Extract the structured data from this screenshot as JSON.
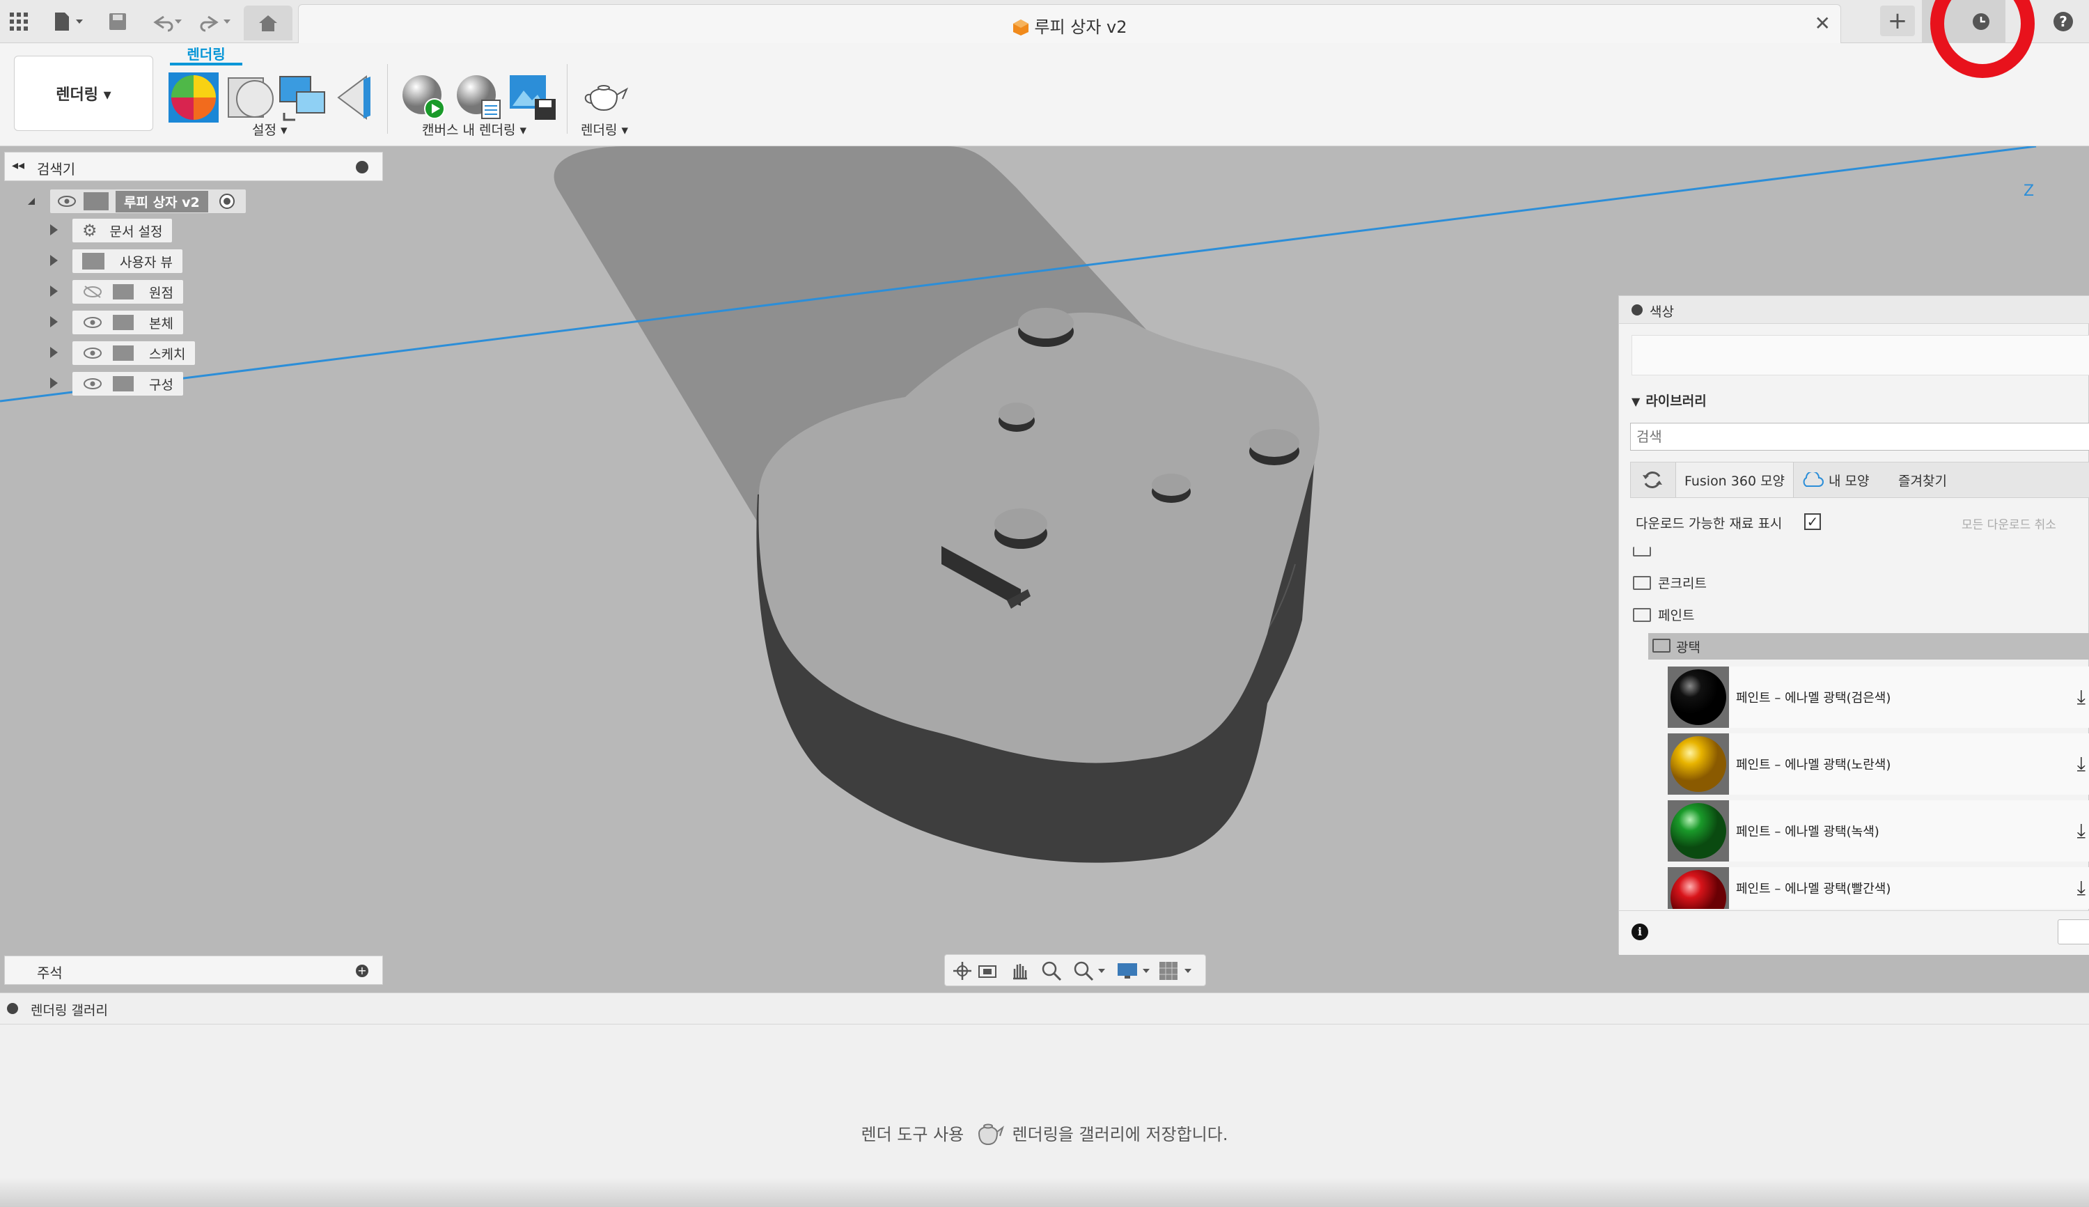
{
  "window": {
    "title": "루피 상자 v2"
  },
  "toolbar": {
    "workspace_label": "렌더링 ▾",
    "active_tab": "렌더링",
    "setup_group": "설정 ▾",
    "canvas_render_group": "캔버스 내 렌더링 ▾",
    "render_group": "렌더링 ▾"
  },
  "browser": {
    "title": "검색기",
    "root": "루피 상자 v2",
    "items": [
      {
        "label": "문서 설정"
      },
      {
        "label": "사용자 뷰"
      },
      {
        "label": "원점"
      },
      {
        "label": "본체"
      },
      {
        "label": "스케치"
      },
      {
        "label": "구성"
      }
    ]
  },
  "comments": {
    "title": "주석"
  },
  "appearance": {
    "title": "색상",
    "library_label": "라이브러리",
    "search_placeholder": "검색",
    "tabs": [
      "Fusion 360 모양",
      "내 모양",
      "즐겨찾기"
    ],
    "downloadable_label": "다운로드 가능한 재료 표시",
    "cancel_all": "모든 다운로드 취소",
    "folders": [
      "콘크리트",
      "페인트"
    ],
    "subfolder": "광택",
    "materials": [
      {
        "label": "페인트 – 에나멜 광택(검은색)",
        "color": "#111111"
      },
      {
        "label": "페인트 – 에나멜 광택(노란색)",
        "color": "#e8b400"
      },
      {
        "label": "페인트 – 에나멜 광택(녹색)",
        "color": "#1a9a2a"
      },
      {
        "label": "페인트 – 에나멜 광택(빨간색)",
        "color": "#d8141a"
      }
    ]
  },
  "viewcube": {
    "axis_z": "Z"
  },
  "gallery": {
    "title": "렌더링 갤러리",
    "hint_pre": "렌더 도구 사용",
    "hint_post": "렌더링을 갤러리에 저장합니다."
  },
  "colors": {
    "accent": "#0696d7",
    "annotation_ring": "#e8121c"
  }
}
